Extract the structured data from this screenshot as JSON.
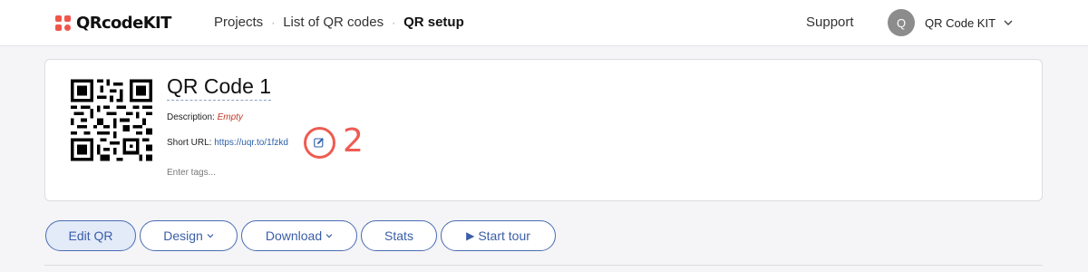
{
  "header": {
    "logo_text": "QRcodeKIT",
    "breadcrumb": {
      "projects": "Projects",
      "list": "List of QR codes",
      "current": "QR setup",
      "separator": "·"
    },
    "support": "Support",
    "user": {
      "initial": "Q",
      "name": "QR Code KIT"
    }
  },
  "card": {
    "title": "QR Code 1",
    "description_label": "Description:",
    "description_value": "Empty",
    "short_url_label": "Short URL:",
    "short_url": "https://uqr.to/1fzkd",
    "tags_placeholder": "Enter tags...",
    "callout_number": "2"
  },
  "buttons": {
    "edit_qr": "Edit QR",
    "design": "Design",
    "download": "Download",
    "stats": "Stats",
    "start_tour": "Start tour"
  },
  "colors": {
    "accent": "#3a5ea8",
    "brand_red": "#f0554a",
    "callout": "#ef5b52"
  },
  "icons": [
    "qr-logo-icon",
    "chevron-down-icon",
    "edit-icon",
    "play-icon"
  ]
}
